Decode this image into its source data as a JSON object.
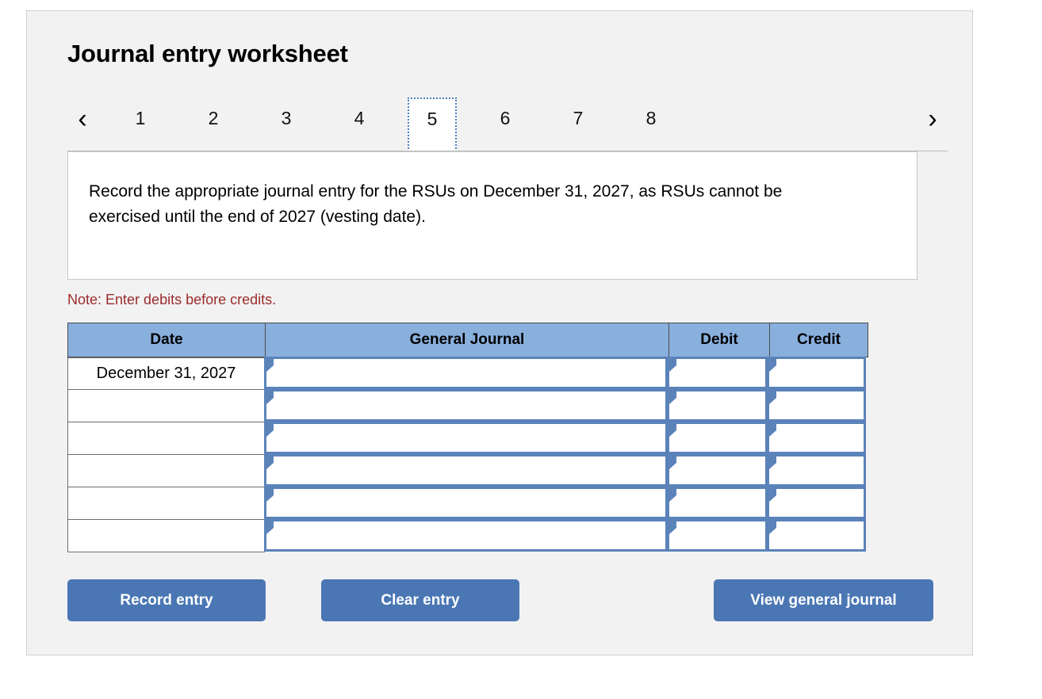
{
  "worksheet": {
    "title": "Journal entry worksheet",
    "note": "Note: Enter debits before credits.",
    "instruction": "Record the appropriate journal entry for the RSUs on December 31, 2027, as RSUs cannot be exercised until the end of 2027 (vesting date)."
  },
  "navigation": {
    "prev_icon": "‹",
    "next_icon": "›",
    "tabs": [
      {
        "label": "1",
        "active": false
      },
      {
        "label": "2",
        "active": false
      },
      {
        "label": "3",
        "active": false
      },
      {
        "label": "4",
        "active": false
      },
      {
        "label": "5",
        "active": true
      },
      {
        "label": "6",
        "active": false
      },
      {
        "label": "7",
        "active": false
      },
      {
        "label": "8",
        "active": false
      }
    ]
  },
  "table": {
    "columns": [
      "Date",
      "General Journal",
      "Debit",
      "Credit"
    ],
    "rows": [
      {
        "date": "December 31, 2027",
        "general_journal": "",
        "debit": "",
        "credit": ""
      },
      {
        "date": "",
        "general_journal": "",
        "debit": "",
        "credit": ""
      },
      {
        "date": "",
        "general_journal": "",
        "debit": "",
        "credit": ""
      },
      {
        "date": "",
        "general_journal": "",
        "debit": "",
        "credit": ""
      },
      {
        "date": "",
        "general_journal": "",
        "debit": "",
        "credit": ""
      },
      {
        "date": "",
        "general_journal": "",
        "debit": "",
        "credit": ""
      }
    ]
  },
  "buttons": {
    "record_entry": "Record entry",
    "clear_entry": "Clear entry",
    "view_general_journal": "View general journal"
  },
  "colors": {
    "header_blue": "#89afdd",
    "button_blue": "#4a77b4",
    "cell_border_blue": "#5b83b9",
    "note_red": "#9c2b2b",
    "card_background": "#f2f2f2"
  }
}
